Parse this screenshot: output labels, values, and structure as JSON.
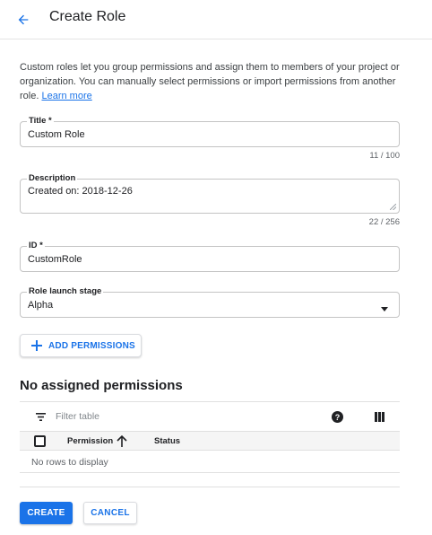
{
  "header": {
    "back_icon": "arrow-back-icon",
    "title": "Create Role"
  },
  "intro": {
    "text": "Custom roles let you group permissions and assign them to members of your project or organization. You can manually select permissions or import permissions from another role.",
    "learn_more": "Learn more"
  },
  "form": {
    "title": {
      "label": "Title",
      "required_mark": "*",
      "value": "Custom Role",
      "counter": "11 / 100"
    },
    "description": {
      "label": "Description",
      "value": "Created on: 2018-12-26",
      "counter": "22 / 256"
    },
    "id": {
      "label": "ID",
      "required_mark": "*",
      "value": "CustomRole"
    },
    "launch_stage": {
      "label": "Role launch stage",
      "selected": "Alpha",
      "icon": "dropdown-arrow-icon"
    }
  },
  "add_permissions": {
    "icon": "plus-icon",
    "label": "ADD PERMISSIONS"
  },
  "permissions_section": {
    "title": "No assigned permissions",
    "toolbar": {
      "filter_icon": "filter-icon",
      "filter_placeholder": "Filter table",
      "help_icon": "help-icon",
      "columns_icon": "column-display-icon"
    },
    "table": {
      "columns": [
        "Permission",
        "Status"
      ],
      "sort_icon": "arrow-up-icon",
      "empty_message": "No rows to display"
    }
  },
  "actions": {
    "create": "CREATE",
    "cancel": "CANCEL"
  },
  "colors": {
    "accent": "#1a73e8",
    "text": "#202124",
    "muted": "#5f6368",
    "border": "#c4c4c4"
  }
}
